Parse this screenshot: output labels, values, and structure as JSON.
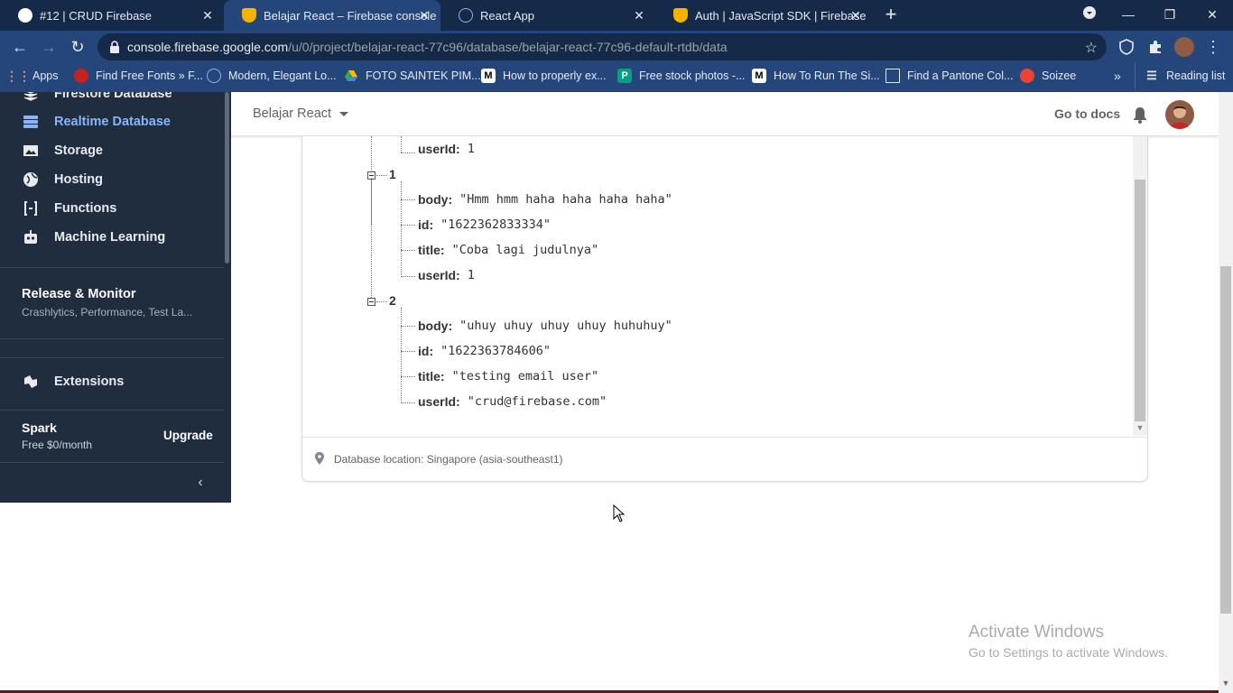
{
  "browser": {
    "tabs": [
      {
        "title": "#12 | CRUD Firebase",
        "active": false,
        "icon": "github-icon"
      },
      {
        "title": "Belajar React – Firebase console",
        "active": true,
        "icon": "firebase-icon"
      },
      {
        "title": "React App",
        "active": false,
        "icon": "react-icon"
      },
      {
        "title": "Auth | JavaScript SDK | Firebase",
        "active": false,
        "icon": "firebase-icon"
      }
    ],
    "url_host": "console.firebase.google.com",
    "url_path": "/u/0/project/belajar-react-77c96/database/belajar-react-77c96-default-rtdb/data",
    "bookmarks": [
      {
        "label": "Apps",
        "icon": "apps-grid-icon"
      },
      {
        "label": "Find Free Fonts » F...",
        "icon": "fonts-icon"
      },
      {
        "label": "Modern, Elegant Lo...",
        "icon": "logo-icon"
      },
      {
        "label": "FOTO SAINTEK PIM...",
        "icon": "drive-icon"
      },
      {
        "label": "How to properly ex...",
        "icon": "medium-icon"
      },
      {
        "label": "Free stock photos -...",
        "icon": "pexels-icon"
      },
      {
        "label": "How To Run The Si...",
        "icon": "medium-icon"
      },
      {
        "label": "Find a Pantone Col...",
        "icon": "pantone-icon"
      },
      {
        "label": "Soizee",
        "icon": "soizee-icon"
      }
    ],
    "reading_list": "Reading list"
  },
  "sidebar": {
    "items": [
      {
        "label": "Firestore Database",
        "icon": "firestore-icon",
        "active": false
      },
      {
        "label": "Realtime Database",
        "icon": "database-icon",
        "active": true
      },
      {
        "label": "Storage",
        "icon": "storage-icon",
        "active": false
      },
      {
        "label": "Hosting",
        "icon": "hosting-icon",
        "active": false
      },
      {
        "label": "Functions",
        "icon": "functions-icon",
        "active": false
      },
      {
        "label": "Machine Learning",
        "icon": "ml-robot-icon",
        "active": false
      }
    ],
    "release_title": "Release & Monitor",
    "release_sub": "Crashlytics, Performance, Test La...",
    "extensions_label": "Extensions",
    "plan_name": "Spark",
    "plan_price": "Free $0/month",
    "upgrade_label": "Upgrade"
  },
  "topbar": {
    "project_name": "Belajar React",
    "docs_label": "Go to docs"
  },
  "tree": {
    "prev_tail": {
      "key": "userId:",
      "value": "1"
    },
    "nodes": [
      {
        "key": "1",
        "fields": [
          {
            "key": "body:",
            "value": "\"Hmm hmm haha haha haha haha\""
          },
          {
            "key": "id:",
            "value": "\"1622362833334\""
          },
          {
            "key": "title:",
            "value": "\"Coba lagi judulnya\""
          },
          {
            "key": "userId:",
            "value": "1"
          }
        ]
      },
      {
        "key": "2",
        "fields": [
          {
            "key": "body:",
            "value": "\"uhuy uhuy uhuy uhuy huhuhuy\""
          },
          {
            "key": "id:",
            "value": "\"1622363784606\""
          },
          {
            "key": "title:",
            "value": "\"testing email user\""
          },
          {
            "key": "userId:",
            "value": "\"crud@firebase.com\""
          }
        ]
      }
    ]
  },
  "footer": {
    "location": "Database location: Singapore (asia-southeast1)"
  },
  "watermark": {
    "title": "Activate Windows",
    "subtitle": "Go to Settings to activate Windows."
  },
  "colors": {
    "chrome_dark": "#152a48",
    "chrome": "#25467a",
    "sidebar": "#1f2d3f",
    "accent": "#8ab4f8"
  }
}
